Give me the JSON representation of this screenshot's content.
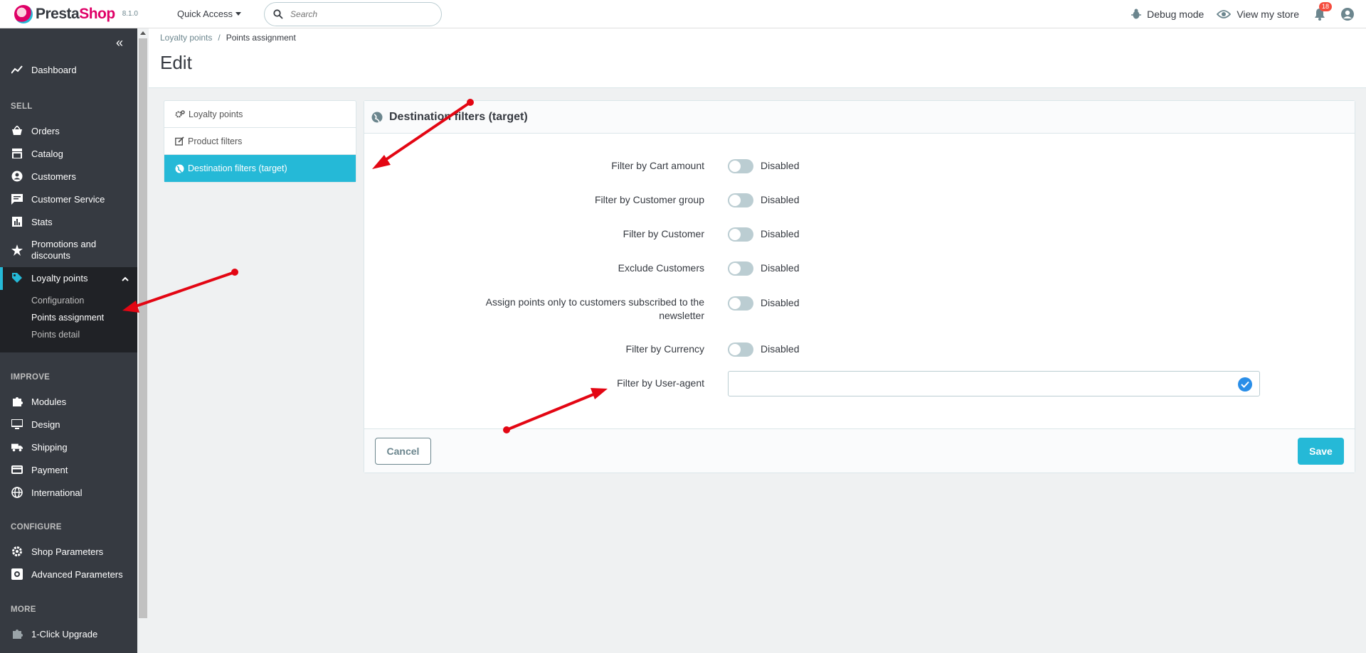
{
  "header": {
    "logo_text_a": "Presta",
    "logo_text_b": "Shop",
    "version": "8.1.0",
    "quick_access": "Quick Access",
    "search_placeholder": "Search",
    "debug_mode": "Debug mode",
    "view_store": "View my store",
    "notifications_count": "18"
  },
  "sidebar": {
    "dashboard": "Dashboard",
    "sections": {
      "sell": "SELL",
      "improve": "IMPROVE",
      "configure": "CONFIGURE",
      "more": "MORE"
    },
    "sell_items": [
      "Orders",
      "Catalog",
      "Customers",
      "Customer Service",
      "Stats"
    ],
    "promotions": [
      "Promotions and",
      "discounts"
    ],
    "loyalty": "Loyalty points",
    "loyalty_sub": [
      "Configuration",
      "Points assignment",
      "Points detail"
    ],
    "improve_items": [
      "Modules",
      "Design",
      "Shipping",
      "Payment",
      "International"
    ],
    "configure_items": [
      "Shop Parameters",
      "Advanced Parameters"
    ],
    "more_items": [
      "1-Click Upgrade"
    ]
  },
  "breadcrumb": {
    "parent": "Loyalty points",
    "separator": "/",
    "current": "Points assignment"
  },
  "page_title": "Edit",
  "tabs": [
    "Loyalty points",
    "Product filters",
    "Destination filters (target)"
  ],
  "panel": {
    "title": "Destination filters (target)",
    "rows": [
      {
        "label": "Filter by Cart amount",
        "state": "Disabled"
      },
      {
        "label": "Filter by Customer group",
        "state": "Disabled"
      },
      {
        "label": "Filter by Customer",
        "state": "Disabled"
      },
      {
        "label": "Exclude Customers",
        "state": "Disabled"
      },
      {
        "label_line1": "Assign points only to customers subscribed to the",
        "label_line2": "newsletter",
        "state": "Disabled"
      },
      {
        "label": "Filter by Currency",
        "state": "Disabled"
      }
    ],
    "ua_label": "Filter by User-agent",
    "ua_value": "",
    "cancel": "Cancel",
    "save": "Save"
  },
  "colors": {
    "accent": "#25b9d7",
    "sidebar": "#363a41",
    "arrow": "#e30613"
  }
}
